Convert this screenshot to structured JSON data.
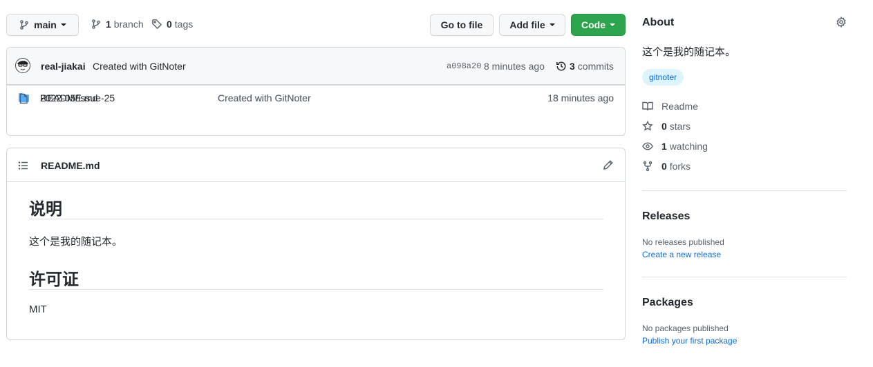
{
  "toolbar": {
    "branch_label": "main",
    "branch_count": "1",
    "branch_word": "branch",
    "tag_count": "0",
    "tag_word": "tags",
    "go_to_file": "Go to file",
    "add_file": "Add file",
    "code": "Code"
  },
  "commit": {
    "author": "real-jiakai",
    "message": "Created with GitNoter",
    "sha": "a098a20",
    "time": "8 minutes ago",
    "count": "3",
    "count_word": "commits"
  },
  "files": [
    {
      "name": "2022-05/issue-25",
      "type": "folder",
      "message": "Created with GitNoter",
      "age": "8 minutes ago"
    },
    {
      "name": "README.md",
      "type": "file",
      "message": "Created with GitNoter",
      "age": "13 minutes ago"
    }
  ],
  "readme": {
    "filename": "README.md",
    "h1": "说明",
    "p1": "这个是我的随记本。",
    "h2": "许可证",
    "p2": "MIT"
  },
  "about": {
    "title": "About",
    "description": "这个是我的随记本。",
    "topic": "gitnoter",
    "readme_label": "Readme",
    "stars_count": "0",
    "stars_word": "stars",
    "watching_count": "1",
    "watching_word": "watching",
    "forks_count": "0",
    "forks_word": "forks"
  },
  "releases": {
    "title": "Releases",
    "none_text": "No releases published",
    "create_link": "Create a new release"
  },
  "packages": {
    "title": "Packages",
    "none_text": "No packages published",
    "publish_link": "Publish your first package"
  },
  "colors": {
    "code_button": "#2da44e",
    "folder_icon": "#54aeff",
    "link": "#0969da",
    "topic_bg": "#ddf4ff"
  },
  "icons": [
    "branch-icon",
    "tag-icon",
    "history-icon",
    "folder-icon",
    "file-icon",
    "list-icon",
    "pencil-icon",
    "gear-icon",
    "book-icon",
    "star-icon",
    "eye-icon",
    "fork-icon"
  ]
}
